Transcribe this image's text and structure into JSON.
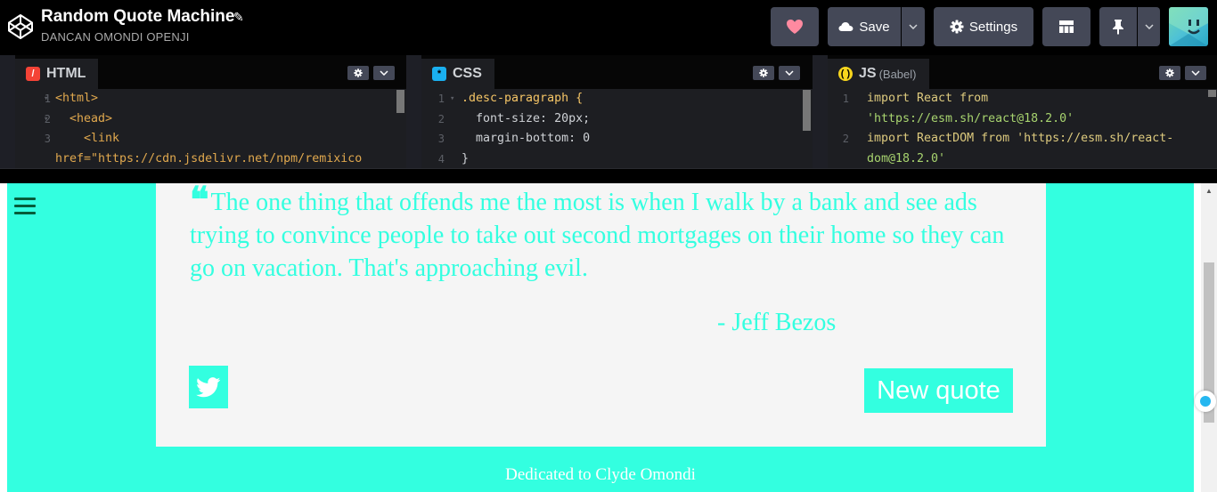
{
  "header": {
    "title": "Random Quote Machine",
    "author": "DANCAN OMONDI OPENJI",
    "save_label": "Save",
    "settings_label": "Settings"
  },
  "editors": {
    "html": {
      "tab_label": "HTML",
      "lines": [
        {
          "n": "1",
          "text": "<html>"
        },
        {
          "n": "2",
          "text": "  <head>"
        },
        {
          "n": "3",
          "text": "    <link"
        },
        {
          "n": "",
          "text": "href=\"https://cdn.jsdelivr.net/npm/remixico"
        }
      ]
    },
    "css": {
      "tab_label": "CSS",
      "lines": [
        {
          "n": "1",
          "text": ".desc-paragraph {"
        },
        {
          "n": "2",
          "text": "  font-size: 20px;"
        },
        {
          "n": "3",
          "text": "  margin-bottom: 0"
        },
        {
          "n": "4",
          "text": "}"
        }
      ]
    },
    "js": {
      "tab_label": "JS",
      "tab_sub": "(Babel)",
      "lines": [
        {
          "n": "1",
          "text": "import React from"
        },
        {
          "n": "",
          "text": "'https://esm.sh/react@18.2.0'"
        },
        {
          "n": "2",
          "text": "import ReactDOM from 'https://esm.sh/react-"
        },
        {
          "n": "",
          "text": "dom@18.2.0'"
        }
      ]
    }
  },
  "preview": {
    "quote_mark": "❝",
    "quote_text": "The one thing that offends me the most is when I walk by a bank and see ads trying to convince people to take out second mortgages on their home so they can go on vacation. That's approaching evil.",
    "quote_author": "- Jeff Bezos",
    "new_quote_label": "New quote",
    "dedication": "Dedicated to Clyde Omondi"
  },
  "colors": {
    "accent": "#33ffe0",
    "header_bg": "#000000",
    "button_bg": "#444857",
    "heart": "#ff8aa0"
  },
  "icons": {
    "logo": "codepen-logo-icon",
    "heart": "heart-icon",
    "save": "cloud-icon",
    "settings": "gear-icon",
    "layout": "layout-grid-icon",
    "pin": "pin-icon",
    "tweet": "twitter-icon",
    "menu": "hamburger-icon"
  }
}
